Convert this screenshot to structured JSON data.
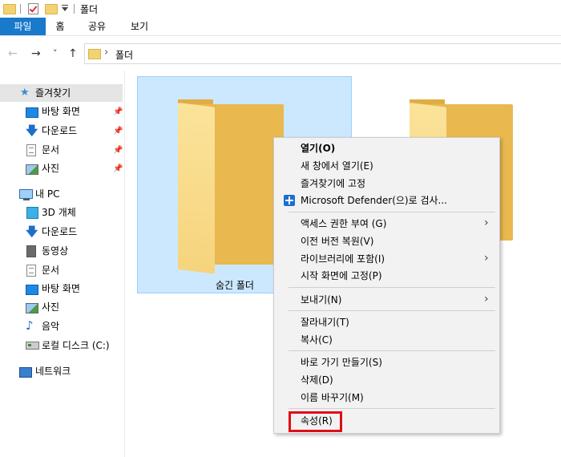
{
  "titlebar": {
    "title": "폴더"
  },
  "ribbon": {
    "tabs": [
      "파일",
      "홈",
      "공유",
      "보기"
    ]
  },
  "address": {
    "path_sep": "›",
    "path": "폴더"
  },
  "nav": {
    "back": "←",
    "forward": "→",
    "recent": "˅",
    "up": "↑"
  },
  "sidebar": {
    "quick_access": "즐겨찾기",
    "quick_items": [
      "바탕 화면",
      "다운로드",
      "문서",
      "사진"
    ],
    "pc": "내 PC",
    "pc_items": [
      "3D 개체",
      "다운로드",
      "동영상",
      "문서",
      "바탕 화면",
      "사진",
      "음악",
      "로컬 디스크 (C:)"
    ],
    "network": "네트워크"
  },
  "content": {
    "folder_label": "숨긴 폴더"
  },
  "context_menu": {
    "items": [
      "열기(O)",
      "새 창에서 열기(E)",
      "즐겨찾기에 고정",
      "Microsoft Defender(으)로 검사...",
      "액세스 권한 부여 (G)",
      "이전 버전 복원(V)",
      "라이브러리에 포함(I)",
      "시작 화면에 고정(P)",
      "보내기(N)",
      "잘라내기(T)",
      "복사(C)",
      "바로 가기 만들기(S)",
      "삭제(D)",
      "이름 바꾸기(M)",
      "속성(R)"
    ],
    "submenu_arrow": "›"
  },
  "colors": {
    "file_tab": "#1979ca",
    "selection": "#cce8ff",
    "highlight_box": "#e00d16"
  }
}
